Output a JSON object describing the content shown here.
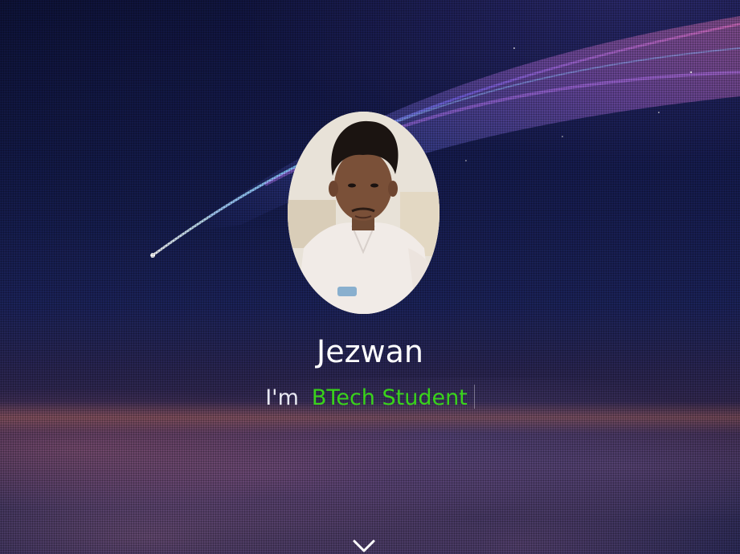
{
  "profile": {
    "name": "Jezwan",
    "tagline_prefix": "I'm",
    "tagline_role": "BTech Student"
  },
  "colors": {
    "accent": "#39d31a",
    "text": "#ffffff",
    "background_top": "#0d1236",
    "background_bottom": "#1f2350"
  },
  "icons": {
    "scroll_down": "chevron-down-icon"
  }
}
